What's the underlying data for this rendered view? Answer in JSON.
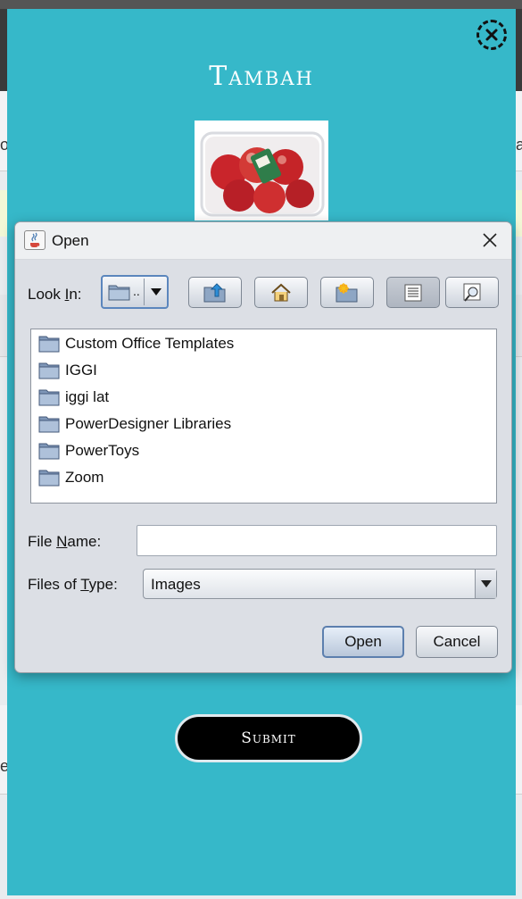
{
  "modal": {
    "title": "Tambah",
    "submit_label": "Submit"
  },
  "dialog": {
    "title": "Open",
    "look_in": {
      "label_pre": "Look ",
      "label_mnemonic": "I",
      "label_post": "n:",
      "current_value": ".."
    },
    "toolbar": [
      "up-one-level",
      "home",
      "create-new-folder",
      "list-view",
      "details-view"
    ],
    "files": [
      {
        "name": "Custom Office Templates",
        "icon": "folder-icon"
      },
      {
        "name": "IGGI",
        "icon": "folder-icon"
      },
      {
        "name": "iggi lat",
        "icon": "folder-icon"
      },
      {
        "name": "PowerDesigner Libraries",
        "icon": "folder-icon"
      },
      {
        "name": "PowerToys",
        "icon": "folder-icon"
      },
      {
        "name": "Zoom",
        "icon": "folder-icon"
      }
    ],
    "file_name": {
      "label_pre": "File ",
      "label_mnemonic": "N",
      "label_post": "ame:",
      "value": ""
    },
    "files_of_type": {
      "label_pre": "Files of ",
      "label_mnemonic": "T",
      "label_post": "ype:",
      "value": "Images"
    },
    "open_label": "Open",
    "cancel_label": "Cancel"
  },
  "background": {
    "edge_letters": [
      "o",
      "ra",
      "e"
    ]
  },
  "colors": {
    "modal_bg": "#36b8c9",
    "submit_bg": "#000000",
    "dialog_bg": "#dcdfe5",
    "focus_border": "#5b86bd"
  }
}
